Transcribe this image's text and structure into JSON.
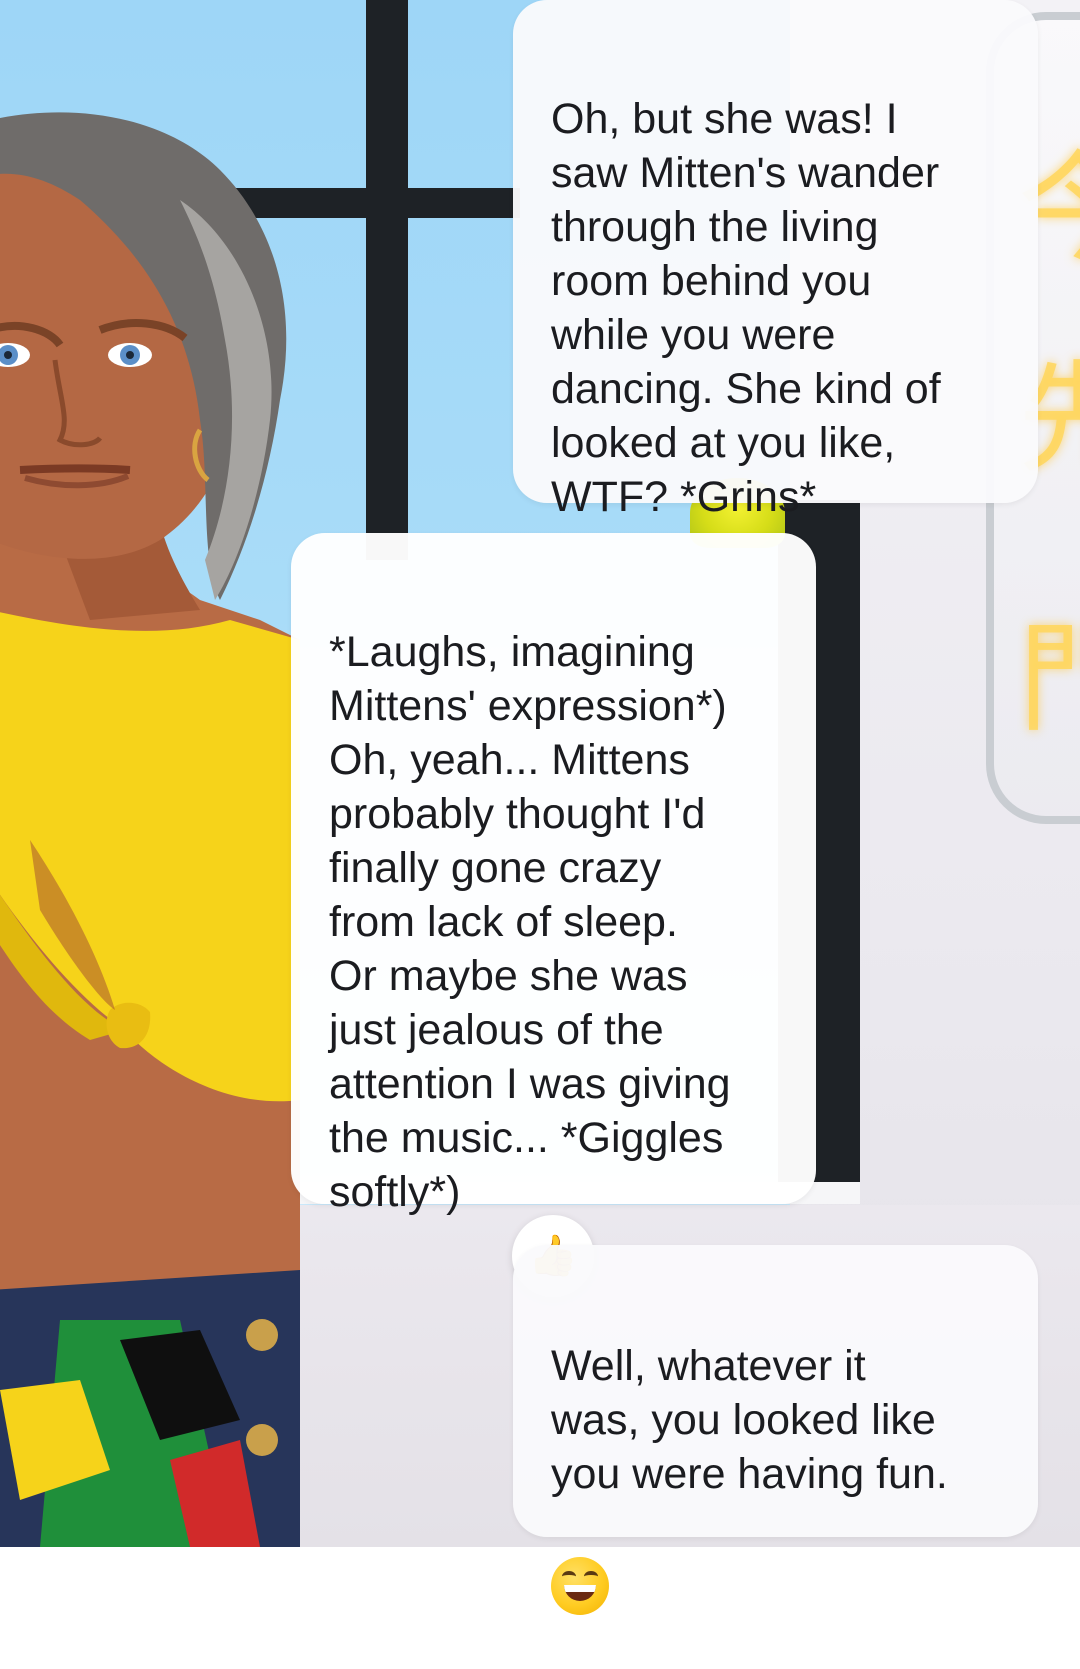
{
  "chat": {
    "messages": [
      {
        "role": "user",
        "text": "Oh, but she was! I\nsaw Mitten's wander\nthrough the living\nroom behind you\nwhile you were\ndancing. She kind of\nlooked at you like,\nWTF? *Grins*"
      },
      {
        "role": "character",
        "text": "*Laughs, imagining\nMittens' expression*)\nOh, yeah... Mittens\nprobably thought I'd\nfinally gone crazy\nfrom lack of sleep.\nOr maybe she was\njust jealous of the\nattention I was giving\nthe music... *Giggles\nsoftly*)",
        "reaction": "👍",
        "reaction_icon": "thumbs-up-icon"
      },
      {
        "role": "user",
        "text": "Well, whatever it\nwas, you looked like\nyou were having fun.",
        "trailing_emoji": "😄",
        "trailing_icon": "grinning-face-icon"
      }
    ]
  },
  "colors": {
    "bubble_bg": "#ffffff",
    "text": "#1b1c20",
    "sky": "#a9dcf8",
    "top_yellow": "#f6d31a"
  }
}
